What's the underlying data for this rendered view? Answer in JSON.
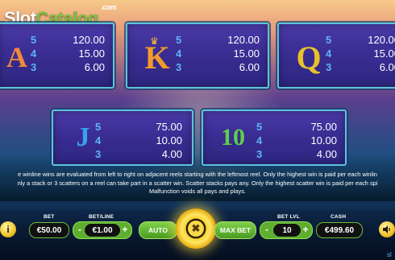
{
  "watermark": {
    "slot": "Slot",
    "catalog": "Catalog",
    "com": ".com"
  },
  "paytable": {
    "row1": [
      {
        "symbol": "seahorse",
        "letter": "A",
        "pays": [
          {
            "count": "5",
            "amount": "120.00"
          },
          {
            "count": "4",
            "amount": "15.00"
          },
          {
            "count": "3",
            "amount": "6.00"
          }
        ]
      },
      {
        "symbol": "crown-k",
        "letter": "K",
        "pays": [
          {
            "count": "5",
            "amount": "120.00"
          },
          {
            "count": "4",
            "amount": "15.00"
          },
          {
            "count": "3",
            "amount": "6.00"
          }
        ]
      },
      {
        "symbol": "q-snake",
        "letter": "Q",
        "pays": [
          {
            "count": "5",
            "amount": "120.00"
          },
          {
            "count": "4",
            "amount": "15.00"
          },
          {
            "count": "3",
            "amount": "6.00"
          }
        ]
      }
    ],
    "row2": [
      {
        "symbol": "jester-j",
        "letter": "J",
        "pays": [
          {
            "count": "5",
            "amount": "75.00"
          },
          {
            "count": "4",
            "amount": "10.00"
          },
          {
            "count": "3",
            "amount": "4.00"
          }
        ]
      },
      {
        "symbol": "ten",
        "letter": "10",
        "pays": [
          {
            "count": "5",
            "amount": "75.00"
          },
          {
            "count": "4",
            "amount": "10.00"
          },
          {
            "count": "3",
            "amount": "4.00"
          }
        ]
      }
    ]
  },
  "rules": {
    "line1": "e winline wins are evaluated from left to right on adjacent reels starting with the leftmost reel. Only the highest win is paid per each winlin",
    "line2": "nly a stack or 3 scatters on a reel can take part in a scatter win. Scatter stacks pays any. Only the highest scatter win is paid per each spi",
    "line3": "Malfunction voids all pays and plays."
  },
  "controls": {
    "info_icon": "i",
    "bet_label": "BET",
    "bet_value": "€50.00",
    "betline_label": "BET/LINE",
    "betline_value": "€1.00",
    "minus": "-",
    "plus": "+",
    "auto_label": "AUTO",
    "spin_icon": "✖",
    "maxbet_label": "MAX BET",
    "betlvl_label": "BET LVL",
    "betlvl_value": "10",
    "cash_label": "CASH",
    "cash_value": "€499.60",
    "sound_icon": "speaker-icon",
    "partial_right": "sl"
  },
  "colors": {
    "panel": "#3a2d93",
    "panel_border": "#5ec3d8",
    "count": "#5fb4f0",
    "accent_green": "#6bc13b",
    "spin_gold": "#f3d12e"
  }
}
